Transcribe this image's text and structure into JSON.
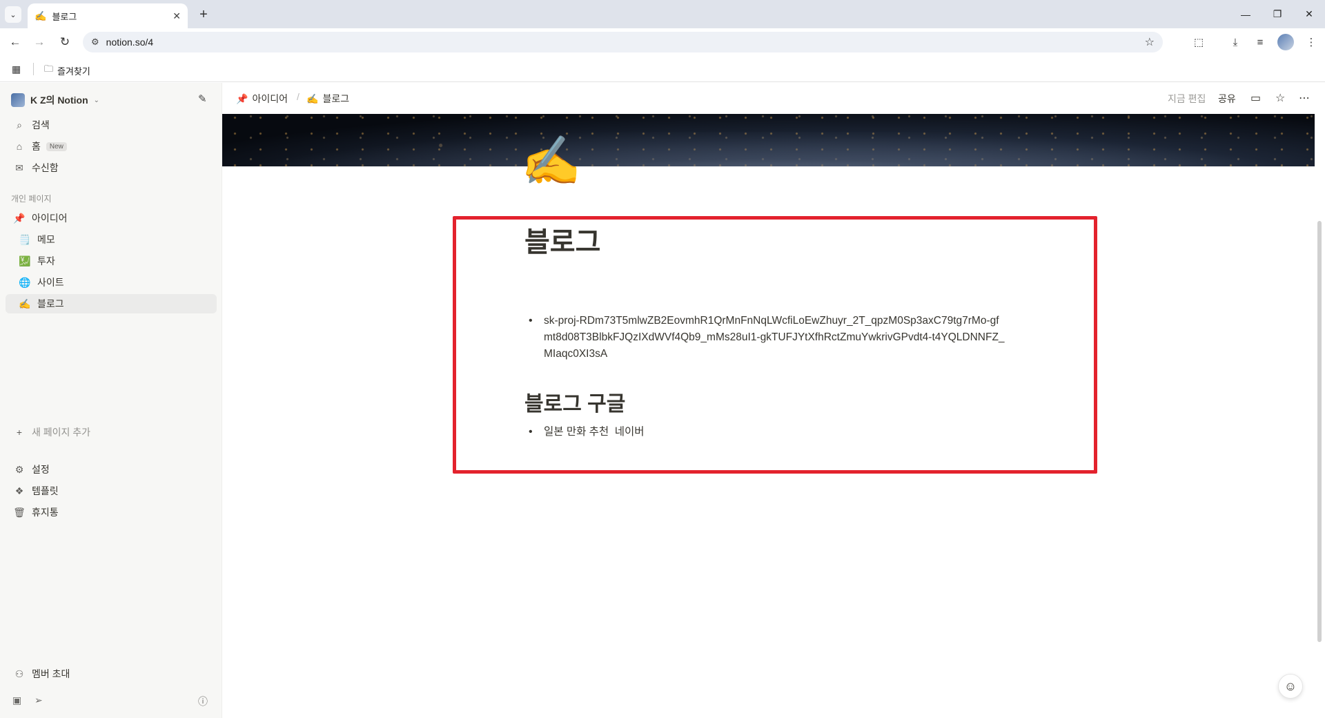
{
  "browser": {
    "tab_title": "블로그",
    "tab_favicon": "✍️",
    "url": "notion.so/4",
    "bookmark_folder": "즐겨찾기"
  },
  "sidebar": {
    "workspace_name": "K Z의 Notion",
    "items": [
      {
        "label": "검색",
        "icon": "search-icon"
      },
      {
        "label": "홈",
        "icon": "home-icon",
        "badge": "New"
      },
      {
        "label": "수신함",
        "icon": "inbox-icon"
      }
    ],
    "section_label": "개인 페이지",
    "pages": [
      {
        "label": "아이디어",
        "emoji": "📌"
      },
      {
        "label": "메모",
        "emoji": "🗒️"
      },
      {
        "label": "투자",
        "emoji": "💹"
      },
      {
        "label": "사이트",
        "emoji": "🌐"
      },
      {
        "label": "블로그",
        "emoji": "✍️"
      }
    ],
    "add_page": "새 페이지 추가",
    "bottom_items": [
      {
        "label": "설정",
        "icon": "settings-icon"
      },
      {
        "label": "템플릿",
        "icon": "template-icon"
      },
      {
        "label": "휴지통",
        "icon": "trash-icon"
      }
    ],
    "invite": "멤버 초대"
  },
  "topbar": {
    "breadcrumb": [
      {
        "label": "아이디어",
        "emoji": "📌"
      },
      {
        "label": "블로그",
        "emoji": "✍️"
      }
    ],
    "edited": "지금 편집",
    "share": "공유"
  },
  "page": {
    "icon": "✍️",
    "title": "블로그",
    "bullets": [
      "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"
    ],
    "heading2": "블로그 구글",
    "bullets2": [
      "일본 만화 추천  네이버"
    ]
  }
}
